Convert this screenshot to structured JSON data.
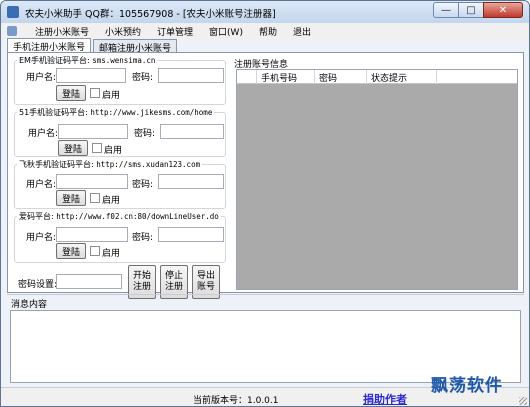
{
  "titlebar": {
    "title": "农夫小米助手          QQ群：105567908 - [农夫小米账号注册器]",
    "minimize_glyph": "—",
    "restore_glyph": "□",
    "close_glyph": "✕"
  },
  "menu": [
    "注册小米账号",
    "小米预约",
    "订单管理",
    "窗口(W)",
    "帮助",
    "退出"
  ],
  "tabs": [
    "手机注册小米账号",
    "邮箱注册小米账号"
  ],
  "groups": [
    {
      "legend": "EM手机验证码平台:",
      "url": "sms.wensima.cn",
      "user_label": "用户名:",
      "pwd_label": "密码:",
      "login": "登陆",
      "enable": "启用"
    },
    {
      "legend": "51手机验证码平台:",
      "url": "http://www.jikesms.com/home",
      "user_label": "用户名:",
      "pwd_label": "密码:",
      "login": "登陆",
      "enable": "启用"
    },
    {
      "legend": "飞秋手机验证码平台:",
      "url": "http://sms.xudan123.com",
      "user_label": "用户名:",
      "pwd_label": "密码:",
      "login": "登陆",
      "enable": "启用"
    },
    {
      "legend": "爱码平台:",
      "url": "http://www.f02.cn:80/downLineUser.do",
      "user_label": "用户名:",
      "pwd_label": "密码:",
      "login": "登陆",
      "enable": "启用"
    }
  ],
  "pwd_setting": {
    "label": "密码设置:"
  },
  "actions": {
    "start": [
      "开始",
      "注册"
    ],
    "stop": [
      "停止",
      "注册"
    ],
    "export": [
      "导出",
      "账号"
    ]
  },
  "accounts": {
    "title": "注册账号信息",
    "columns": [
      "手机号码",
      "密码",
      "状态提示"
    ]
  },
  "messages": {
    "title": "消息内容"
  },
  "status": {
    "version": "当前版本号：1.0.0.1",
    "donate": "捐助作者"
  },
  "watermark": "飘荡软件"
}
